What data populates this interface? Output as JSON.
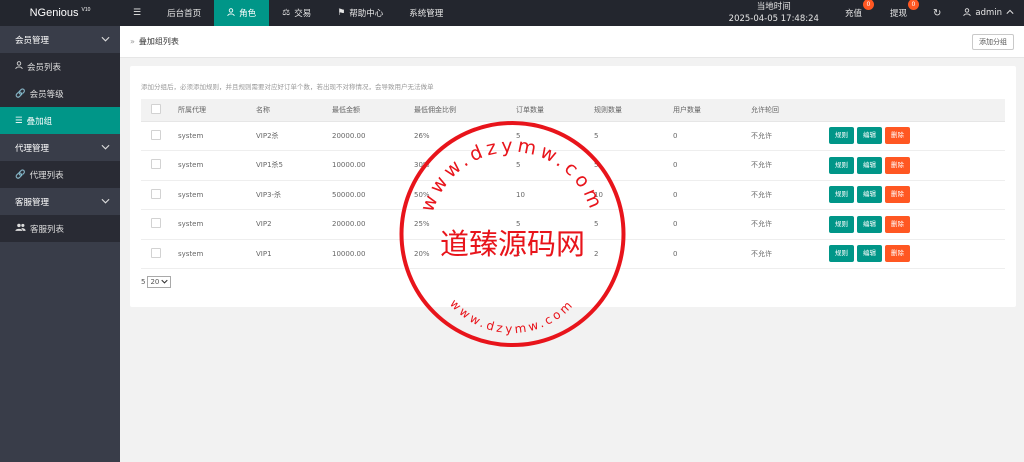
{
  "app": {
    "logo": "NGenious",
    "version": "V10"
  },
  "nav": {
    "menu_icon": "menu-icon",
    "items": [
      {
        "label": "后台首页",
        "icon": ""
      },
      {
        "label": "角色",
        "icon": "user-icon",
        "active": true
      },
      {
        "label": "交易",
        "icon": "scale-icon"
      },
      {
        "label": "帮助中心",
        "icon": "flag-icon"
      },
      {
        "label": "系统管理",
        "icon": ""
      }
    ]
  },
  "header": {
    "clock_label": "当地时间",
    "clock_value": "2025-04-05 17:48:24",
    "recharge_label": "充值",
    "recharge_count": "0",
    "withdraw_label": "提现",
    "withdraw_count": "0",
    "user_name": "admin"
  },
  "sidebar": {
    "groups": [
      {
        "label": "会员管理",
        "items": [
          {
            "label": "会员列表",
            "icon": "user-icon"
          },
          {
            "label": "会员等级",
            "icon": "link-icon"
          },
          {
            "label": "叠加组",
            "icon": "list-icon",
            "active": true
          }
        ]
      },
      {
        "label": "代理管理",
        "items": [
          {
            "label": "代理列表",
            "icon": "link-icon"
          }
        ]
      },
      {
        "label": "客服管理",
        "items": [
          {
            "label": "客服列表",
            "icon": "users-icon"
          }
        ]
      }
    ]
  },
  "page": {
    "breadcrumb": "叠加组列表",
    "add_button": "添加分组",
    "note": "添加分组后，必须添加规则，并且规则需要对应好订单个数，若出现不对称情况，会导致用户无法做单"
  },
  "table": {
    "columns": [
      "所属代理",
      "名称",
      "最低金额",
      "最低佣金比例",
      "订单数量",
      "规则数量",
      "用户数量",
      "允许轮回"
    ],
    "rows": [
      {
        "agent": "system",
        "name": "VIP2杀",
        "min_amount": "20000.00",
        "ratio": "26%",
        "orders": "5",
        "rules": "5",
        "users": "0",
        "loop": "不允许"
      },
      {
        "agent": "system",
        "name": "VIP1杀5",
        "min_amount": "10000.00",
        "ratio": "30%",
        "orders": "5",
        "rules": "5",
        "users": "0",
        "loop": "不允许"
      },
      {
        "agent": "system",
        "name": "VIP3-杀",
        "min_amount": "50000.00",
        "ratio": "50%",
        "orders": "10",
        "rules": "10",
        "users": "0",
        "loop": "不允许"
      },
      {
        "agent": "system",
        "name": "VIP2",
        "min_amount": "20000.00",
        "ratio": "25%",
        "orders": "5",
        "rules": "5",
        "users": "0",
        "loop": "不允许"
      },
      {
        "agent": "system",
        "name": "VIP1",
        "min_amount": "10000.00",
        "ratio": "20%",
        "orders": "2",
        "rules": "2",
        "users": "0",
        "loop": "不允许"
      }
    ],
    "actions": {
      "rule": "规则",
      "edit": "编辑",
      "delete": "删除"
    }
  },
  "pager": {
    "total": "5",
    "page_size": "20"
  },
  "watermark": {
    "top_text": "www.dzymw.com",
    "bottom_text": "www.dzymw.com",
    "center_text": "道臻源码网",
    "color": "#e8141b"
  },
  "colors": {
    "topbar": "#23262e",
    "sidebar": "#393d49",
    "accent": "#009688",
    "danger": "#ff5722"
  }
}
